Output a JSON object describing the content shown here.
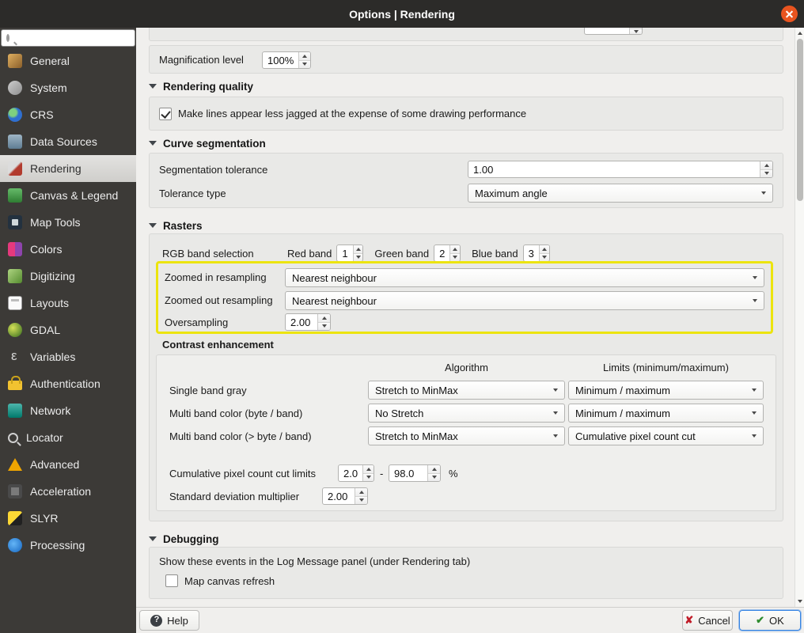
{
  "window": {
    "title": "Options | Rendering"
  },
  "sidebar": {
    "items": [
      {
        "label": "General",
        "icon": "wrench-icon"
      },
      {
        "label": "System",
        "icon": "gears-icon"
      },
      {
        "label": "CRS",
        "icon": "globe-icon"
      },
      {
        "label": "Data Sources",
        "icon": "database-icon"
      },
      {
        "label": "Rendering",
        "icon": "paintbrush-icon",
        "selected": true
      },
      {
        "label": "Canvas & Legend",
        "icon": "canvas-icon"
      },
      {
        "label": "Map Tools",
        "icon": "map-tools-icon"
      },
      {
        "label": "Colors",
        "icon": "palette-icon"
      },
      {
        "label": "Digitizing",
        "icon": "digitizing-icon"
      },
      {
        "label": "Layouts",
        "icon": "page-icon"
      },
      {
        "label": "GDAL",
        "icon": "gdal-globe-icon"
      },
      {
        "label": "Variables",
        "icon": "epsilon-icon"
      },
      {
        "label": "Authentication",
        "icon": "lock-icon"
      },
      {
        "label": "Network",
        "icon": "network-icon"
      },
      {
        "label": "Locator",
        "icon": "magnifier-icon"
      },
      {
        "label": "Advanced",
        "icon": "warning-icon"
      },
      {
        "label": "Acceleration",
        "icon": "chip-icon"
      },
      {
        "label": "SLYR",
        "icon": "slyr-icon"
      },
      {
        "label": "Processing",
        "icon": "processing-gear-icon"
      }
    ]
  },
  "content": {
    "magnification": {
      "label": "Magnification level",
      "value": "100%"
    },
    "rendering_quality": {
      "title": "Rendering quality",
      "antialias": "Make lines appear less jagged at the expense of some drawing performance",
      "antialias_checked": true
    },
    "curve_segmentation": {
      "title": "Curve segmentation",
      "tolerance_label": "Segmentation tolerance",
      "tolerance_value": "1.00",
      "type_label": "Tolerance type",
      "type_value": "Maximum angle"
    },
    "rasters": {
      "title": "Rasters",
      "rgb_label": "RGB band selection",
      "red_label": "Red band",
      "red_value": "1",
      "green_label": "Green band",
      "green_value": "2",
      "blue_label": "Blue band",
      "blue_value": "3",
      "zoom_in_label": "Zoomed in resampling",
      "zoom_in_value": "Nearest neighbour",
      "zoom_out_label": "Zoomed out resampling",
      "zoom_out_value": "Nearest neighbour",
      "oversampling_label": "Oversampling",
      "oversampling_value": "2.00"
    },
    "contrast": {
      "title": "Contrast enhancement",
      "col_algorithm": "Algorithm",
      "col_limits": "Limits (minimum/maximum)",
      "rows": [
        {
          "label": "Single band gray",
          "algorithm": "Stretch to MinMax",
          "limits": "Minimum / maximum"
        },
        {
          "label": "Multi band color (byte / band)",
          "algorithm": "No Stretch",
          "limits": "Minimum / maximum"
        },
        {
          "label": "Multi band color (> byte / band)",
          "algorithm": "Stretch to MinMax",
          "limits": "Cumulative pixel count cut"
        }
      ],
      "cum_label": "Cumulative pixel count cut limits",
      "cum_min": "2.0",
      "cum_sep": "-",
      "cum_max": "98.0",
      "cum_unit": "%",
      "stddev_label": "Standard deviation multiplier",
      "stddev_value": "2.00"
    },
    "debugging": {
      "title": "Debugging",
      "log_text": "Show these events in the Log Message panel (under Rendering tab)",
      "map_canvas_refresh": "Map canvas refresh",
      "map_canvas_refresh_checked": false
    }
  },
  "footer": {
    "help": "Help",
    "cancel": "Cancel",
    "ok": "OK"
  }
}
